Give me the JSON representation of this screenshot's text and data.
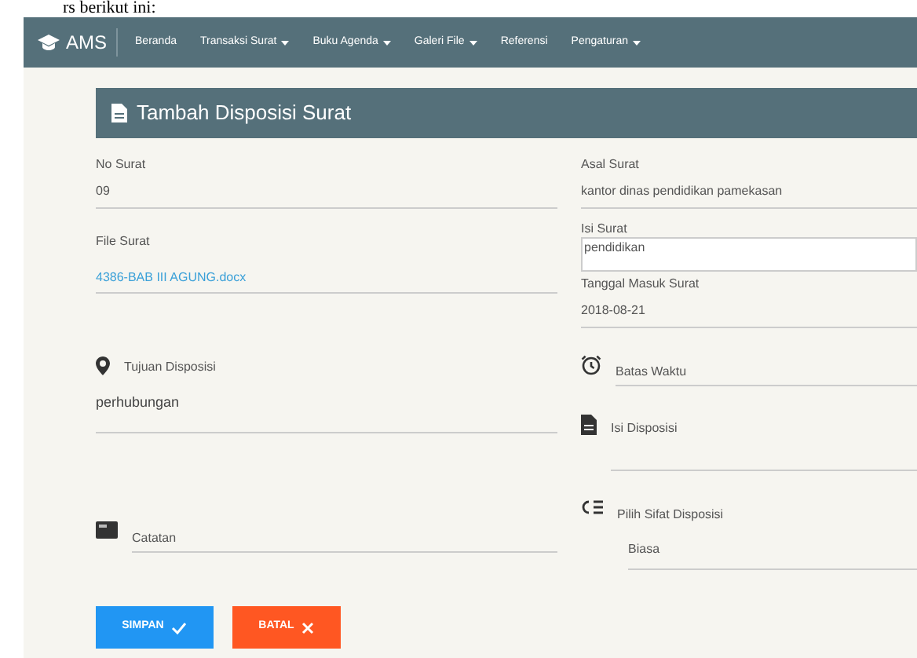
{
  "document_caption": "rs berikut ini:",
  "navbar": {
    "brand": "AMS",
    "items": [
      {
        "label": "Beranda",
        "dropdown": false
      },
      {
        "label": "Transaksi Surat",
        "dropdown": true
      },
      {
        "label": "Buku Agenda",
        "dropdown": true
      },
      {
        "label": "Galeri File",
        "dropdown": true
      },
      {
        "label": "Referensi",
        "dropdown": false
      },
      {
        "label": "Pengaturan",
        "dropdown": true
      }
    ]
  },
  "panel": {
    "title": "Tambah Disposisi Surat"
  },
  "form": {
    "left": [
      {
        "kind": "text",
        "label": "No Surat",
        "value": "09"
      },
      {
        "kind": "link",
        "label": "File Surat",
        "value": "4386-BAB III AGUNG.docx"
      },
      {
        "kind": "icon_text",
        "label": "Tujuan Disposisi",
        "value": "perhubungan"
      },
      {
        "kind": "icon_empty",
        "label": "Catatan"
      }
    ],
    "right": [
      {
        "kind": "text",
        "label": "Asal Surat",
        "value": "kantor dinas pendidikan pamekasan"
      },
      {
        "kind": "textarea",
        "label": "Isi Surat",
        "value": "pendidikan"
      },
      {
        "kind": "text",
        "label": "Tanggal Masuk Surat",
        "value": "2018-08-21"
      },
      {
        "kind": "icon_empty",
        "label": "Batas Waktu"
      },
      {
        "kind": "icon_area",
        "label": "Isi Disposisi"
      },
      {
        "kind": "icon_select",
        "label": "Pilih Sifat Disposisi",
        "value": "Biasa"
      }
    ]
  },
  "buttons": [
    {
      "kind": "save",
      "label": "SIMPAN"
    },
    {
      "kind": "cancel",
      "label": "BATAL"
    }
  ]
}
